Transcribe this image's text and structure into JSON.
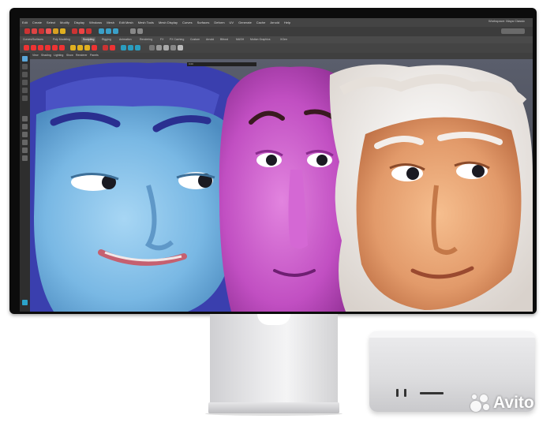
{
  "maya_ui": {
    "menus": [
      "Edit",
      "Create",
      "Select",
      "Modify",
      "Display",
      "Windows",
      "Mesh",
      "Edit Mesh",
      "Mesh Tools",
      "Mesh Display",
      "Curves",
      "Surfaces",
      "Deform",
      "UV",
      "Generate",
      "Cache",
      "Arnold",
      "Help"
    ],
    "workspace_label": "Workspace: Maya Classic",
    "shelf_tabs": [
      "Curves/Surfaces",
      "Poly Modeling",
      "Sculpting",
      "Rigging",
      "Animation",
      "Rendering",
      "FX",
      "FX Caching",
      "Custom",
      "Arnold",
      "Bifrost",
      "MASH",
      "Motion Graphics",
      "XGen"
    ],
    "active_shelf_tab": "Sculpting",
    "panel_menus": [
      "View",
      "Shading",
      "Lighting",
      "Show",
      "Renderer",
      "Panels"
    ],
    "hud_value": "0.00"
  },
  "watermark": {
    "text": "Avito"
  },
  "colors": {
    "blue_face": "#79b8e4",
    "pink_face": "#c14fc2",
    "orange_face": "#e29a6a",
    "hair_blue": "#3a3fae",
    "hair_white": "#f3eeea"
  }
}
